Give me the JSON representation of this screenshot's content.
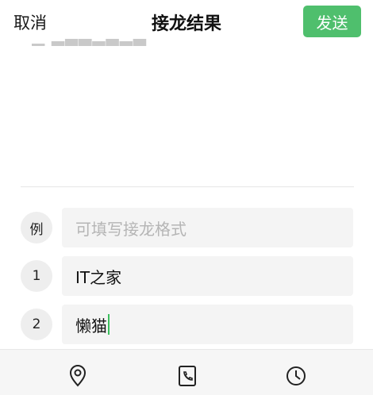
{
  "header": {
    "cancel_label": "取消",
    "title": "接龙结果",
    "send_label": "发送"
  },
  "rows": [
    {
      "badge": "例",
      "placeholder": "可填写接龙格式",
      "value": ""
    },
    {
      "badge": "1",
      "value": "IT之家"
    },
    {
      "badge": "2",
      "value": "懒猫"
    }
  ],
  "toolbar": {
    "icons": [
      "location-icon",
      "phone-icon",
      "clock-icon"
    ]
  },
  "colors": {
    "accent": "#4fbf6d",
    "caret": "#3cbf5e"
  }
}
